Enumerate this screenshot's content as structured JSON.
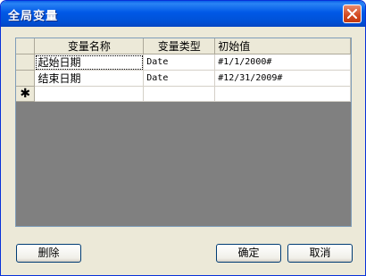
{
  "window": {
    "title": "全局变量"
  },
  "grid": {
    "columns": [
      "变量名称",
      "变量类型",
      "初始值"
    ],
    "rows": [
      {
        "name": "起始日期",
        "type": "Date",
        "initial": "#1/1/2000#"
      },
      {
        "name": "结束日期",
        "type": "Date",
        "initial": "#12/31/2009#"
      }
    ],
    "new_row_marker": "✱"
  },
  "buttons": {
    "delete": "删除",
    "ok": "确定",
    "cancel": "取消"
  },
  "colors": {
    "titlebar": "#0058e6",
    "dialog_bg": "#ece9d8",
    "grid_empty_bg": "#808080",
    "close_button": "#d2491f"
  }
}
